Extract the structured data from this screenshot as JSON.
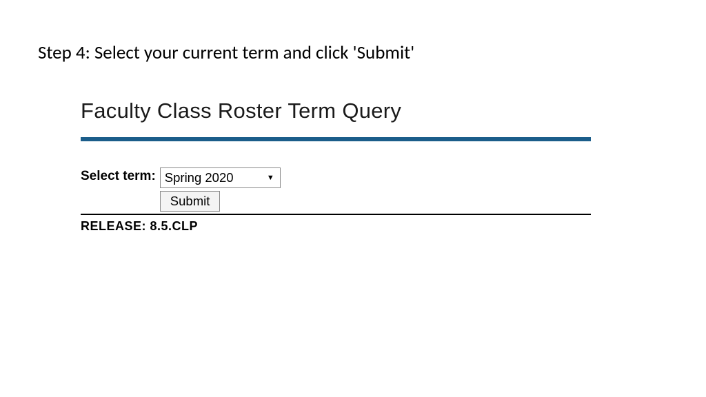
{
  "instruction": {
    "step_text": "Step 4: Select your current term and click 'Submit'"
  },
  "form": {
    "title": "Faculty Class Roster Term Query",
    "label": "Select term:",
    "selected_term": "Spring 2020",
    "submit_label": "Submit"
  },
  "footer": {
    "release": "RELEASE: 8.5.CLP"
  }
}
